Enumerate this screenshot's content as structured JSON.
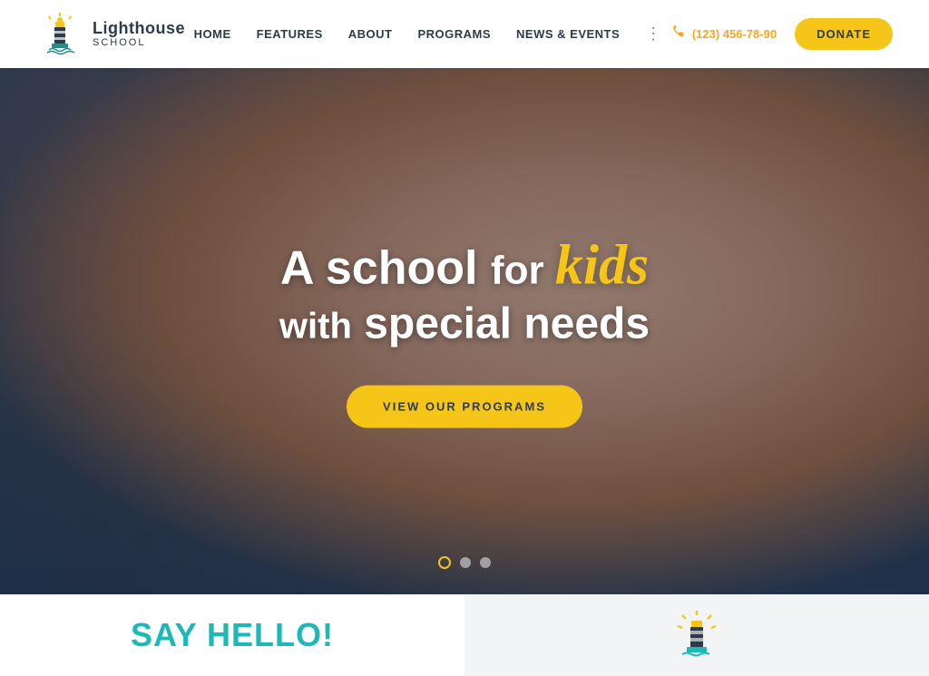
{
  "header": {
    "logo": {
      "title": "Lighthouse",
      "subtitle": "SCHOOL"
    },
    "nav": {
      "items": [
        {
          "label": "HOME",
          "active": true
        },
        {
          "label": "FEATURES",
          "active": false
        },
        {
          "label": "ABOUT",
          "active": false
        },
        {
          "label": "PROGRAMS",
          "active": false
        },
        {
          "label": "NEWS & EVENTS",
          "active": false
        }
      ]
    },
    "phone": "(123) 456-78-90",
    "donate_label": "DONATE"
  },
  "hero": {
    "line1_part1": "A school",
    "line1_for": "for",
    "line1_kids": "kids",
    "line2_with": "with",
    "line2_part2": "special needs",
    "cta_label": "VIEW OUR PROGRAMS",
    "dots": [
      {
        "active": true
      },
      {
        "active": false
      },
      {
        "active": false
      }
    ]
  },
  "bottom": {
    "say_hello": "SAY HELLO!",
    "icon_alt": "lighthouse-icon"
  }
}
